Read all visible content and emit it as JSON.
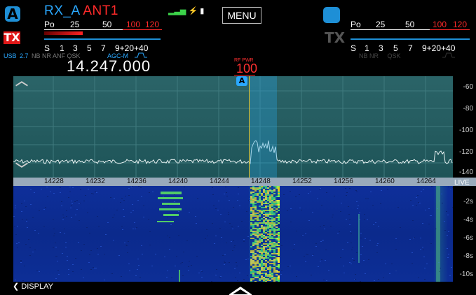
{
  "panel_a": {
    "badge": "A",
    "rx": "RX_A",
    "ant": "ANT1",
    "tx": "TX",
    "power_scale": {
      "p": "Po",
      "v25": "25",
      "v50": "50",
      "v100": "100",
      "v120": "120"
    },
    "s_scale": {
      "s": "S",
      "v1": "1",
      "v3": "3",
      "v5": "5",
      "v7": "7",
      "v9": "9+20+40"
    },
    "status": {
      "mode": "USB",
      "bw": "2.7",
      "flags": "NB NR ANF QSK",
      "agc": "AGC-M"
    },
    "frequency": "14.247.000"
  },
  "menu_label": "MENU",
  "panel_b": {
    "tx": "TX",
    "power_scale": {
      "p": "Po",
      "v25": "25",
      "v50": "50",
      "v100": "100",
      "v120": "120"
    },
    "s_scale": {
      "s": "S",
      "v1": "1",
      "v3": "3",
      "v5": "5",
      "v7": "7",
      "v9": "9+20+40"
    },
    "flags": "NB NR     QSK"
  },
  "rfpwr": {
    "label": "RF PWR",
    "value": "100"
  },
  "spectrum": {
    "badge": "A",
    "db_labels": [
      "-60",
      "-80",
      "-100",
      "-120",
      "-140"
    ],
    "freq_ticks": [
      "14228",
      "14232",
      "14236",
      "14240",
      "14244",
      "14248",
      "14252",
      "14256",
      "14260",
      "14264"
    ],
    "live": "LIVE"
  },
  "waterfall": {
    "time_labels": [
      "-2s",
      "-4s",
      "-6s",
      "-8s",
      "-10s"
    ]
  },
  "display_button": "DISPLAY",
  "colors": {
    "accent": "#1e8fd6",
    "tx_red": "#e01818",
    "tuning": "#e8c020",
    "waterfall": "#0b2a8c"
  }
}
